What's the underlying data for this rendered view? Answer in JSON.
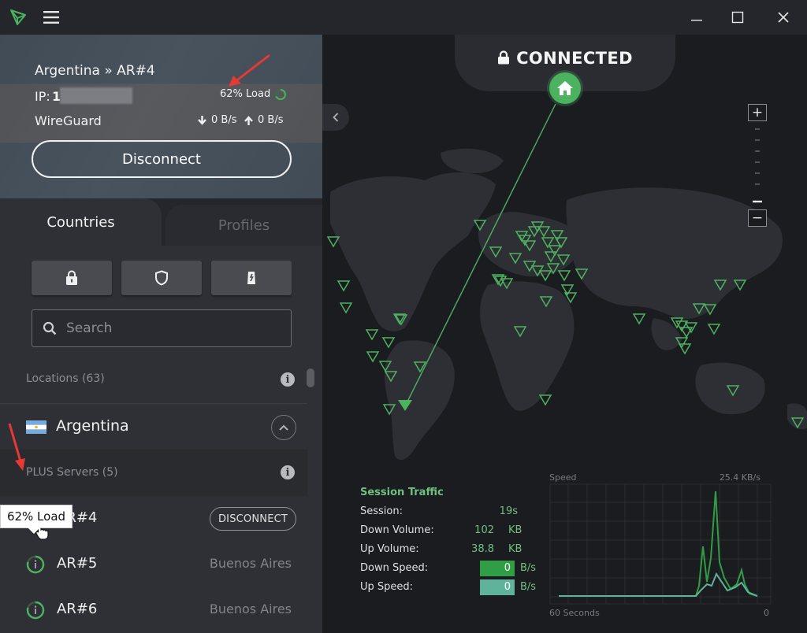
{
  "window": {
    "minimize_glyph": "—",
    "maximize_glyph": "☐",
    "close_glyph": "✕"
  },
  "connection": {
    "location": "Argentina » AR#4",
    "ip_label": "IP:",
    "ip_visible": "1",
    "load": "62% Load",
    "protocol": "WireGuard",
    "down_rate": "0 B/s",
    "up_rate": "0 B/s",
    "disconnect_label": "Disconnect"
  },
  "tabs": {
    "countries": "Countries",
    "profiles": "Profiles"
  },
  "filters": [
    "lock-icon",
    "shield-icon",
    "tor-icon"
  ],
  "search": {
    "placeholder": "Search"
  },
  "locations": {
    "label": "Locations (63)",
    "country": "Argentina",
    "group_label": "PLUS Servers (5)",
    "tooltip": "62% Load",
    "servers": [
      {
        "name": "AR#4",
        "action": "DISCONNECT",
        "load_percent": 62
      },
      {
        "name": "AR#5",
        "city": "Buenos Aires",
        "load_percent": 80
      },
      {
        "name": "AR#6",
        "city": "Buenos Aires",
        "load_percent": 80
      }
    ]
  },
  "map": {
    "status": "CONNECTED",
    "zoom_in": "+",
    "zoom_out": "−"
  },
  "session_traffic": {
    "title": "Session Traffic",
    "session_label": "Session:",
    "session_value": "19s",
    "down_volume_label": "Down Volume:",
    "down_volume_value": "102",
    "down_volume_unit": "KB",
    "up_volume_label": "Up Volume:",
    "up_volume_value": "38.8",
    "up_volume_unit": "KB",
    "down_speed_label": "Down Speed:",
    "down_speed_value": "0",
    "down_speed_unit": "B/s",
    "up_speed_label": "Up Speed:",
    "up_speed_value": "0",
    "up_speed_unit": "B/s"
  },
  "speed_chart": {
    "title": "Speed",
    "max_label": "25.4  KB/s",
    "x_left_label": "60 Seconds",
    "x_right_label": "0"
  },
  "colors": {
    "accent": "#4db25f",
    "down_bar": "#2f9e44",
    "up_bar": "#5fb39a"
  }
}
